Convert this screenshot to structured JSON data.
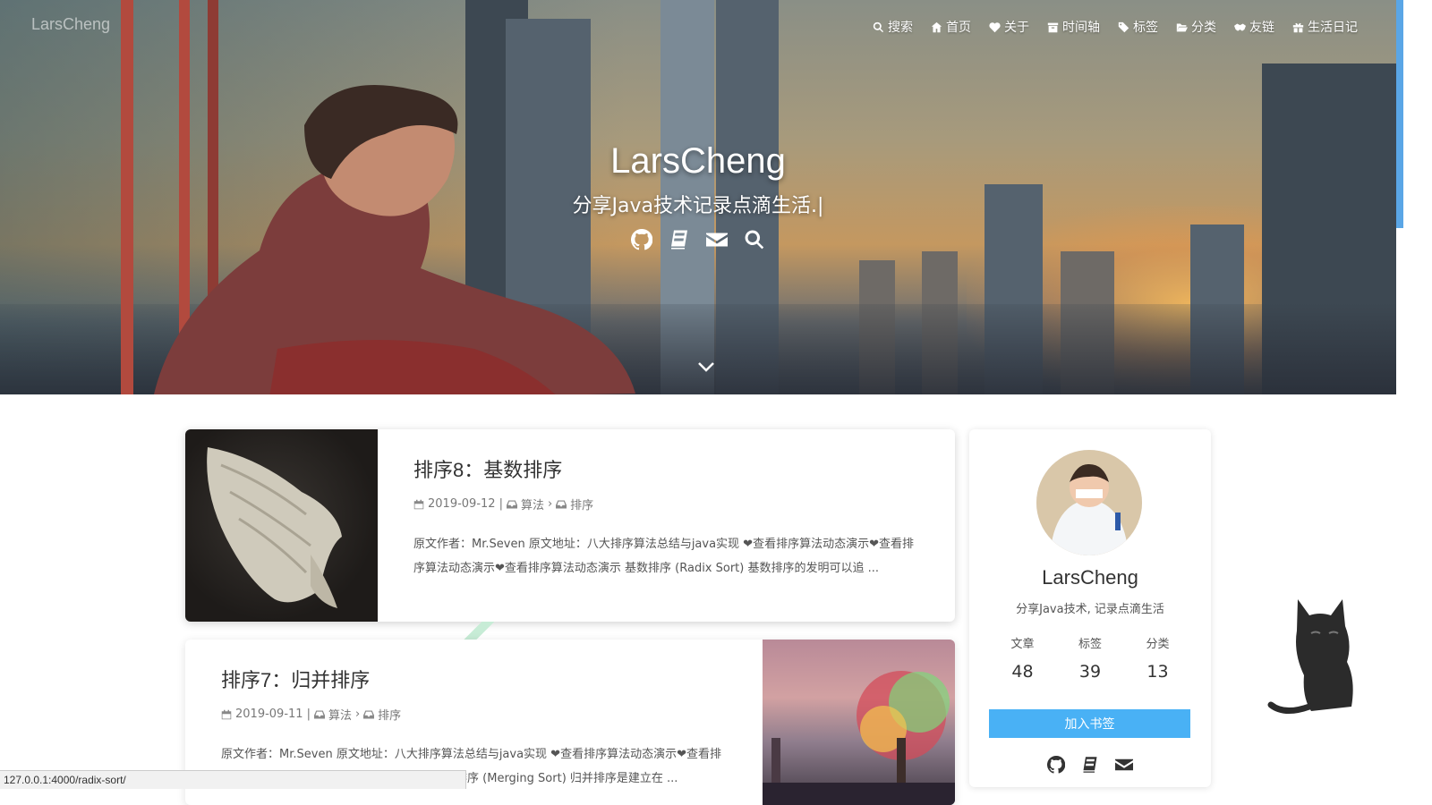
{
  "brand": "LarsCheng",
  "nav": [
    {
      "icon": "search-icon",
      "label": "搜索"
    },
    {
      "icon": "home-icon",
      "label": "首页"
    },
    {
      "icon": "heart-icon",
      "label": "关于"
    },
    {
      "icon": "archive-icon",
      "label": "时间轴"
    },
    {
      "icon": "tags-icon",
      "label": "标签"
    },
    {
      "icon": "folder-open-icon",
      "label": "分类"
    },
    {
      "icon": "handshake-icon",
      "label": "友链"
    },
    {
      "icon": "gift-icon",
      "label": "生活日记"
    }
  ],
  "hero": {
    "title": "LarsCheng",
    "subtitle": "分享Java技术记录点滴生活.|",
    "icons": [
      "github-icon",
      "book-icon",
      "envelope-icon",
      "search-icon"
    ]
  },
  "posts": [
    {
      "title": "排序8：基数排序",
      "date": "2019-09-12",
      "separator": "|",
      "category": "算法",
      "subcategory": "排序",
      "excerpt": "原文作者：Mr.Seven 原文地址：八大排序算法总结与java实现 ❤查看排序算法动态演示❤查看排序算法动态演示❤查看排序算法动态演示 基数排序 (Radix Sort) 基数排序的发明可以追 ..."
    },
    {
      "title": "排序7：归并排序",
      "date": "2019-09-11",
      "separator": "|",
      "category": "算法",
      "subcategory": "排序",
      "excerpt": "原文作者：Mr.Seven 原文地址：八大排序算法总结与java实现 ❤查看排序算法动态演示❤查看排序算法动态演示❤查看排序算法动态演示 归并排序 (Merging Sort) 归并排序是建立在 ..."
    }
  ],
  "profile": {
    "name": "LarsCheng",
    "description": "分享Java技术, 记录点滴生活",
    "stats": [
      {
        "label": "文章",
        "value": "48"
      },
      {
        "label": "标签",
        "value": "39"
      },
      {
        "label": "分类",
        "value": "13"
      }
    ],
    "bookmark_label": "加入书签",
    "icons": [
      "github-icon",
      "book-icon",
      "envelope-icon"
    ]
  },
  "statusbar": "127.0.0.1:4000/radix-sort/",
  "colors": {
    "accent": "#49b1f5",
    "scroll_indicator": "#5aa6e6"
  }
}
